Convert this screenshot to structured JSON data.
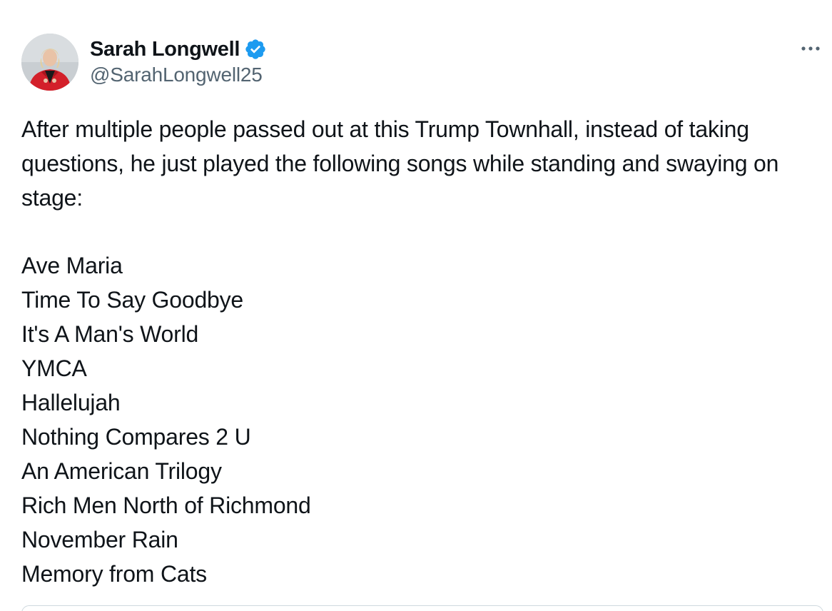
{
  "author": {
    "display_name": "Sarah Longwell",
    "handle": "@SarahLongwell25",
    "verified": true,
    "avatar_icon": "profile-photo",
    "verified_icon": "verified-badge-icon"
  },
  "colors": {
    "text_primary": "#0f1419",
    "text_secondary": "#536471",
    "verified_blue": "#1d9bf0",
    "border": "#cfd9de"
  },
  "tweet": {
    "intro": "After multiple people passed out at this Trump Townhall, instead of taking questions, he just played the following songs while standing and swaying on stage:",
    "songs": [
      "Ave Maria",
      "Time To Say Goodbye",
      "It's A Man's World",
      "YMCA",
      "Hallelujah",
      "Nothing Compares 2 U",
      "An American Trilogy",
      "Rich Men North of Richmond",
      "November Rain",
      "Memory from Cats"
    ]
  },
  "actions": {
    "more_icon": "more-options-icon"
  }
}
